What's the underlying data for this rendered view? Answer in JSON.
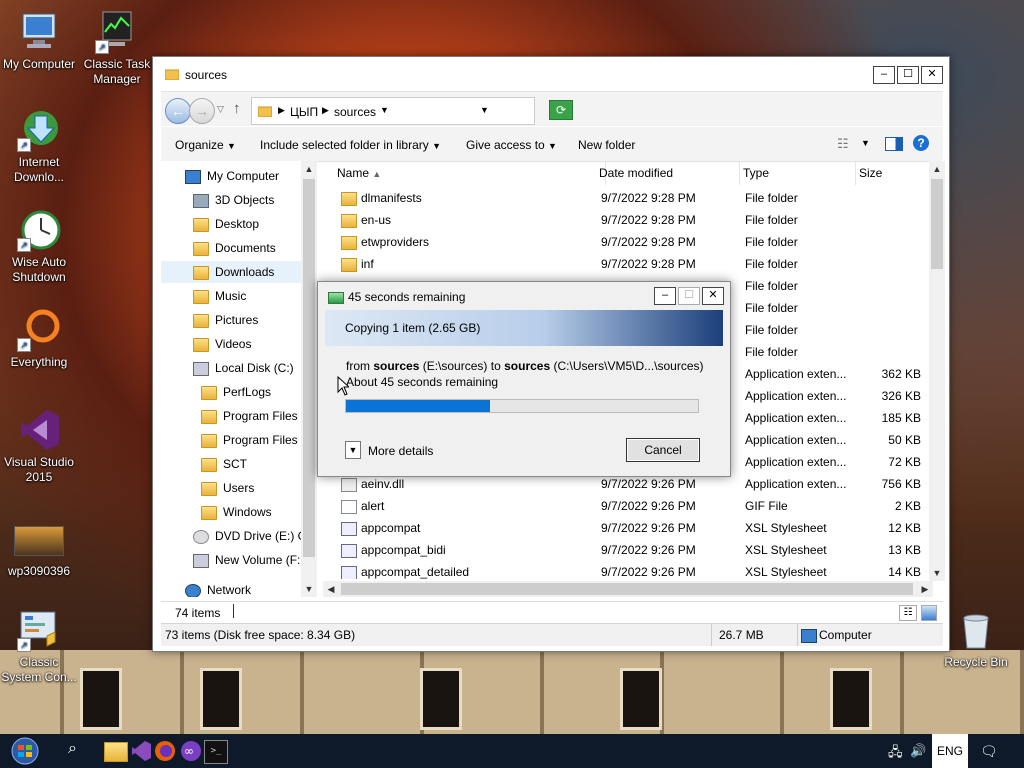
{
  "desktop": {
    "icons": [
      {
        "label": "My Computer"
      },
      {
        "label": "Classic Task Manager"
      },
      {
        "label": "Internet Downlo..."
      },
      {
        "label": "Wise Auto Shutdown"
      },
      {
        "label": "Everything"
      },
      {
        "label": "Visual Studio 2015"
      },
      {
        "label": "wp3090396"
      },
      {
        "label": "Classic System Con..."
      },
      {
        "label": "Recycle Bin"
      }
    ]
  },
  "explorer": {
    "title": "sources",
    "address": {
      "segment1": "ЦЫП",
      "segment2": "sources"
    },
    "toolbar": {
      "organize": "Organize",
      "include": "Include selected folder in library",
      "give_access": "Give access to",
      "new_folder": "New folder"
    },
    "nav": [
      {
        "label": "My Computer"
      },
      {
        "label": "3D Objects"
      },
      {
        "label": "Desktop"
      },
      {
        "label": "Documents"
      },
      {
        "label": "Downloads"
      },
      {
        "label": "Music"
      },
      {
        "label": "Pictures"
      },
      {
        "label": "Videos"
      },
      {
        "label": "Local Disk (C:)"
      },
      {
        "label": "PerfLogs"
      },
      {
        "label": "Program Files"
      },
      {
        "label": "Program Files ("
      },
      {
        "label": "SCT"
      },
      {
        "label": "Users"
      },
      {
        "label": "Windows"
      },
      {
        "label": "DVD Drive (E:) GI"
      },
      {
        "label": "New Volume (F:"
      },
      {
        "label": "Network"
      }
    ],
    "columns": {
      "name": "Name",
      "date": "Date modified",
      "type": "Type",
      "size": "Size"
    },
    "files": [
      {
        "name": "dlmanifests",
        "date": "9/7/2022 9:28 PM",
        "type": "File folder",
        "size": ""
      },
      {
        "name": "en-us",
        "date": "9/7/2022 9:28 PM",
        "type": "File folder",
        "size": ""
      },
      {
        "name": "etwproviders",
        "date": "9/7/2022 9:28 PM",
        "type": "File folder",
        "size": ""
      },
      {
        "name": "inf",
        "date": "9/7/2022 9:28 PM",
        "type": "File folder",
        "size": ""
      },
      {
        "name": "",
        "date": "",
        "type": "File folder",
        "size": ""
      },
      {
        "name": "",
        "date": "",
        "type": "File folder",
        "size": ""
      },
      {
        "name": "",
        "date": "",
        "type": "File folder",
        "size": ""
      },
      {
        "name": "",
        "date": "",
        "type": "File folder",
        "size": ""
      },
      {
        "name": "",
        "date": "",
        "type": "Application exten...",
        "size": "362 KB"
      },
      {
        "name": "",
        "date": "",
        "type": "Application exten...",
        "size": "326 KB"
      },
      {
        "name": "",
        "date": "",
        "type": "Application exten...",
        "size": "185 KB"
      },
      {
        "name": "",
        "date": "",
        "type": "Application exten...",
        "size": "50 KB"
      },
      {
        "name": "",
        "date": "",
        "type": "Application exten...",
        "size": "72 KB"
      },
      {
        "name": "aeinv.dll",
        "date": "9/7/2022 9:26 PM",
        "type": "Application exten...",
        "size": "756 KB"
      },
      {
        "name": "alert",
        "date": "9/7/2022 9:26 PM",
        "type": "GIF File",
        "size": "2 KB"
      },
      {
        "name": "appcompat",
        "date": "9/7/2022 9:26 PM",
        "type": "XSL Stylesheet",
        "size": "12 KB"
      },
      {
        "name": "appcompat_bidi",
        "date": "9/7/2022 9:26 PM",
        "type": "XSL Stylesheet",
        "size": "13 KB"
      },
      {
        "name": "appcompat_detailed",
        "date": "9/7/2022 9:26 PM",
        "type": "XSL Stylesheet",
        "size": "14 KB"
      }
    ],
    "details_count": "74 items",
    "status": {
      "items": "73 items (Disk free space: 8.34 GB)",
      "size": "26.7 MB",
      "location": "Computer"
    }
  },
  "copy_dialog": {
    "title": "45 seconds remaining",
    "heading": "Copying 1 item (2.65 GB)",
    "from_label": "from",
    "src_name": "sources",
    "src_path": "(E:\\sources)",
    "to_label": "to",
    "dst_name": "sources",
    "dst_path": "(C:\\Users\\VM5\\D...\\sources)",
    "remaining": "About 45 seconds remaining",
    "progress": 0.41,
    "more_details": "More details",
    "cancel": "Cancel"
  },
  "taskbar": {
    "language": "ENG"
  },
  "colors": {
    "progress": "#0a74d6",
    "selection": "#e5f1fb",
    "taskbar": "#0e1a2a"
  }
}
